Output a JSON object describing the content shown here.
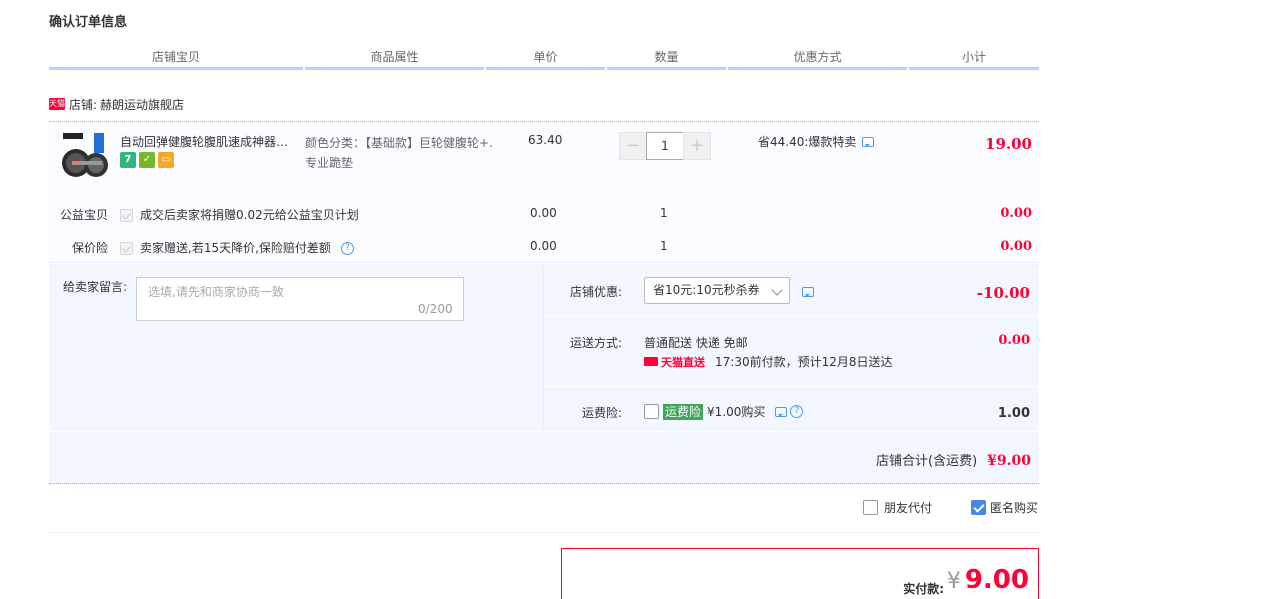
{
  "page_title": "确认订单信息",
  "columns": [
    "店铺宝贝",
    "商品属性",
    "单价",
    "数量",
    "优惠方式",
    "小计"
  ],
  "shop": {
    "badge": "天猫",
    "label": "店铺:",
    "name": "赫朗运动旗舰店"
  },
  "item": {
    "title": "自动回弹健腹轮腹肌速成神器滚轮减肚子男士训练器材家用",
    "service_icons": [
      {
        "text": "7",
        "color": "#2eb67d",
        "name": "seven-day-return-icon"
      },
      {
        "text": "✓",
        "color": "#76b82a",
        "name": "guarantee-icon"
      },
      {
        "text": "▭",
        "color": "#f5a623",
        "name": "credit-card-icon"
      }
    ],
    "attr": "颜色分类：【基础款】巨轮健腹轮+.专业跪垫",
    "price": "63.40",
    "qty_minus": "−",
    "qty": "1",
    "qty_plus": "+",
    "promo": "省44.40:爆款特卖",
    "subtotal": "19.00"
  },
  "charity": {
    "label": "公益宝贝",
    "text": "成交后卖家将捐赠0.02元给公益宝贝计划",
    "price": "0.00",
    "qty": "1",
    "subtotal": "0.00"
  },
  "insurance": {
    "label": "保价险",
    "text": "卖家赠送,若15天降价,保险赔付差额",
    "help": "?",
    "price": "0.00",
    "qty": "1",
    "subtotal": "0.00"
  },
  "note": {
    "label": "给卖家留言:",
    "placeholder": "选填,请先和商家协商一致",
    "count": "0/200"
  },
  "shop_discount": {
    "label": "店铺优惠:",
    "selected": "省10元:10元秒杀券",
    "amount": "-10.00"
  },
  "shipping": {
    "label": "运送方式:",
    "method": "普通配送 快递 免邮",
    "direct": "天猫直送",
    "eta": "17:30前付款，预计12月8日送达",
    "amount": "0.00"
  },
  "freight_insurance": {
    "label": "运费险:",
    "tag": "运费险",
    "price": "¥1.00购买",
    "help": "?",
    "amount": "1.00"
  },
  "shop_total": {
    "label": "店铺合计(含运费)",
    "amount": "¥9.00"
  },
  "options": {
    "friend_pay": "朋友代付",
    "anonymous": "匿名购买"
  },
  "payment": {
    "label": "实付款:",
    "currency": "¥",
    "amount": "9.00"
  },
  "colors": {
    "accent_red": "#ff0036",
    "header_line": "#b2d1ff",
    "panel_bg": "#f2f7ff"
  }
}
